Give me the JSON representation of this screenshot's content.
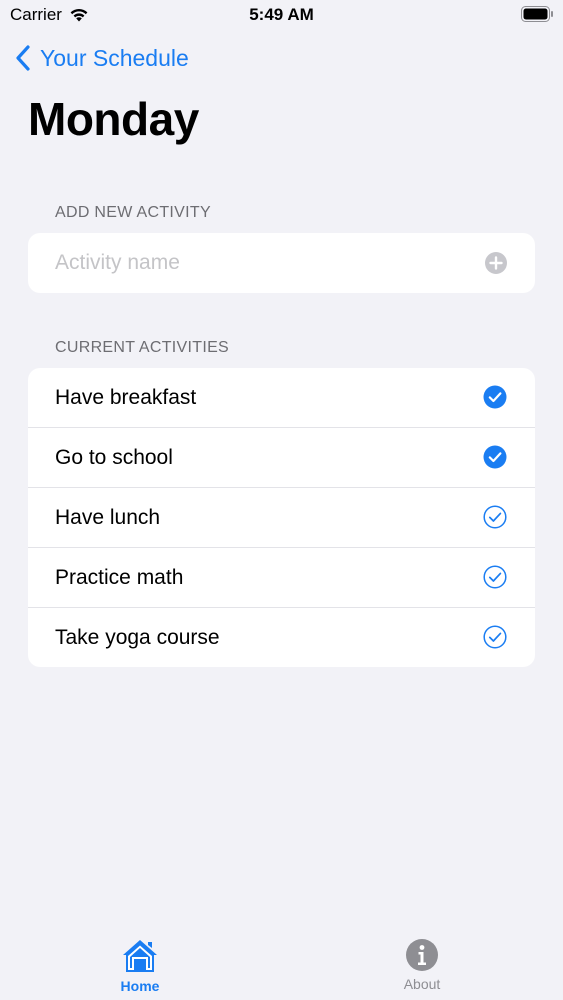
{
  "status": {
    "carrier": "Carrier",
    "time": "5:49 AM"
  },
  "nav": {
    "back_label": "Your Schedule"
  },
  "page": {
    "title": "Monday"
  },
  "add_section": {
    "header": "ADD NEW ACTIVITY",
    "placeholder": "Activity name",
    "value": ""
  },
  "current_section": {
    "header": "CURRENT ACTIVITIES",
    "items": [
      {
        "label": "Have breakfast",
        "done": true
      },
      {
        "label": "Go to school",
        "done": true
      },
      {
        "label": "Have lunch",
        "done": false
      },
      {
        "label": "Practice math",
        "done": false
      },
      {
        "label": "Take yoga course",
        "done": false
      }
    ]
  },
  "tabs": [
    {
      "label": "Home",
      "icon": "house-icon",
      "selected": true
    },
    {
      "label": "About",
      "icon": "info-icon",
      "selected": false
    }
  ],
  "colors": {
    "accent": "#1a7df2",
    "background": "#f2f2f7",
    "inactive": "#8e8e93"
  }
}
